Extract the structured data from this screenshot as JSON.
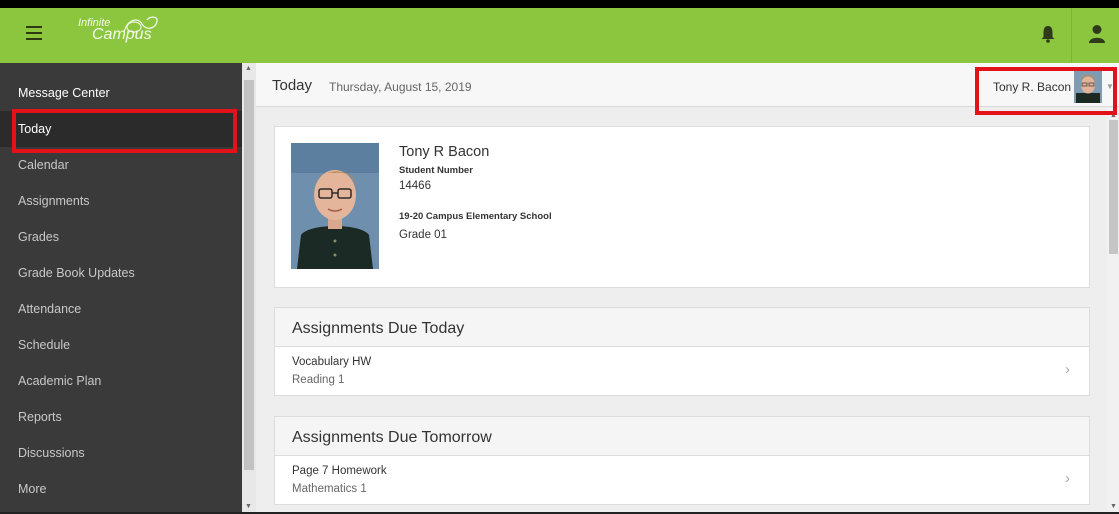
{
  "app": {
    "logo_line1": "Infinite",
    "logo_line2": "Campus",
    "brand_color": "#8cc63f"
  },
  "sidebar": {
    "items": [
      {
        "label": "Message Center"
      },
      {
        "label": "Today",
        "active": true
      },
      {
        "label": "Calendar"
      },
      {
        "label": "Assignments"
      },
      {
        "label": "Grades"
      },
      {
        "label": "Grade Book Updates"
      },
      {
        "label": "Attendance"
      },
      {
        "label": "Schedule"
      },
      {
        "label": "Academic Plan"
      },
      {
        "label": "Reports"
      },
      {
        "label": "Discussions"
      },
      {
        "label": "More"
      }
    ]
  },
  "header": {
    "title": "Today",
    "date": "Thursday, August 15, 2019",
    "user_name": "Tony R. Bacon"
  },
  "student": {
    "name": "Tony R Bacon",
    "number_label": "Student Number",
    "number": "14466",
    "school": "19-20 Campus Elementary School",
    "grade": "Grade 01"
  },
  "sections": [
    {
      "title": "Assignments Due Today",
      "items": [
        {
          "name": "Vocabulary HW",
          "course": "Reading 1"
        }
      ]
    },
    {
      "title": "Assignments Due Tomorrow",
      "items": [
        {
          "name": "Page 7 Homework",
          "course": "Mathematics 1"
        }
      ]
    }
  ],
  "icons": {
    "menu": "hamburger-menu-icon",
    "notifications": "bell-icon",
    "user": "user-icon",
    "chevron": "chevron-right-icon"
  },
  "highlight_color": "#e3111a"
}
